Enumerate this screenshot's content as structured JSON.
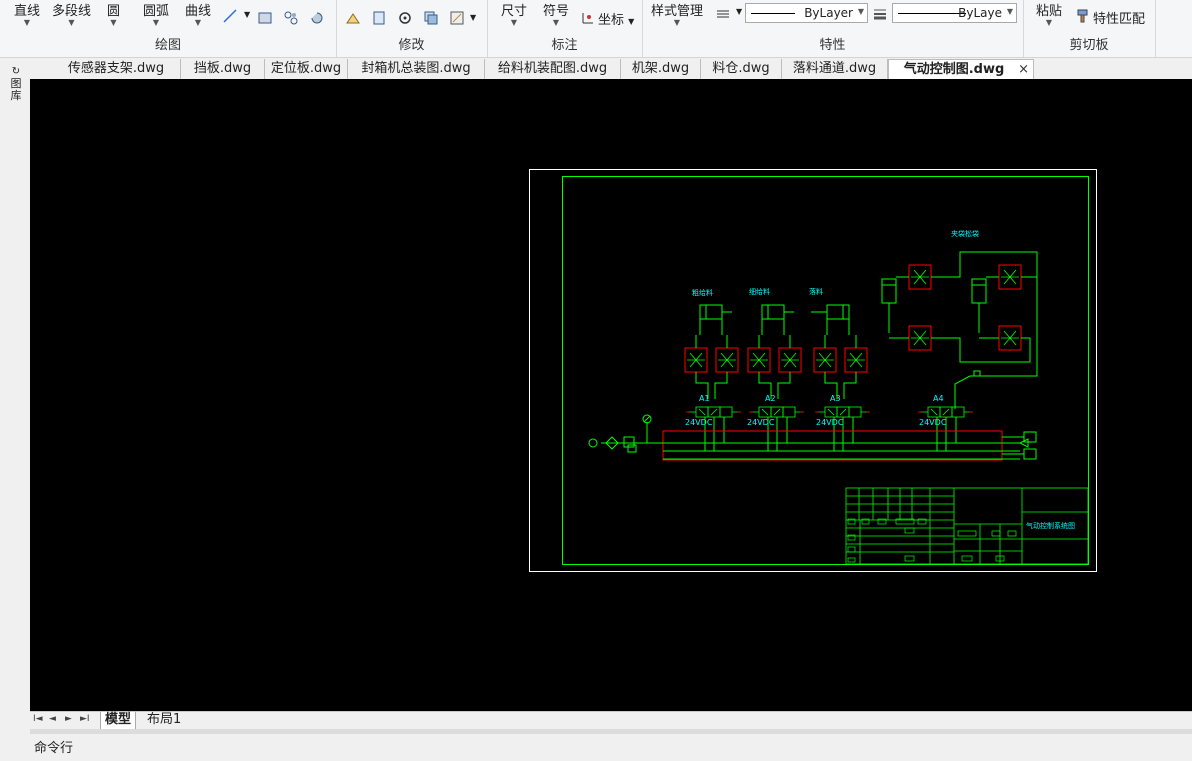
{
  "ribbon": {
    "draw_group": {
      "title": "绘图",
      "line": "直线",
      "polyline": "多段线",
      "circle": "圆",
      "arc": "圆弧",
      "curve": "曲线"
    },
    "modify_group": {
      "title": "修改"
    },
    "annotate_group": {
      "title": "标注",
      "dimension": "尺寸",
      "symbol": "符号",
      "coordinate": "坐标"
    },
    "properties_group": {
      "title": "特性",
      "style_manager": "样式管理",
      "linetype_value": "ByLayer",
      "lineweight_value": "ByLaye"
    },
    "clipboard_group": {
      "title": "剪切板",
      "paste": "粘贴",
      "match_properties": "特性匹配"
    }
  },
  "side_panel": {
    "label": "图库"
  },
  "tabs": [
    {
      "label": "传感器支架.dwg",
      "active": false
    },
    {
      "label": "挡板.dwg",
      "active": false
    },
    {
      "label": "定位板.dwg",
      "active": false
    },
    {
      "label": "封箱机总装图.dwg",
      "active": false
    },
    {
      "label": "给料机装配图.dwg",
      "active": false
    },
    {
      "label": "机架.dwg",
      "active": false
    },
    {
      "label": "料仓.dwg",
      "active": false
    },
    {
      "label": "落料通道.dwg",
      "active": false
    },
    {
      "label": "气动控制图.dwg",
      "active": true
    }
  ],
  "tab_close": "×",
  "drawing": {
    "label_top_right": "夹袋松袋",
    "labels_cylinders": [
      "粗给料",
      "细给料",
      "落料"
    ],
    "valves": [
      {
        "name": "A1",
        "voltage": "24VDC"
      },
      {
        "name": "A2",
        "voltage": "24VDC"
      },
      {
        "name": "A3",
        "voltage": "24VDC"
      },
      {
        "name": "A4",
        "voltage": "24VDC"
      }
    ],
    "title_block_name": "气动控制系统图",
    "colors": {
      "frame": "#ffffff",
      "lines": "#00ff00",
      "text": "#00ffff",
      "valves": "#ff0000"
    }
  },
  "layout_tabs": [
    {
      "label": "模型",
      "active": true
    },
    {
      "label": "布局1",
      "active": false
    }
  ],
  "command": {
    "label": "命令行"
  }
}
